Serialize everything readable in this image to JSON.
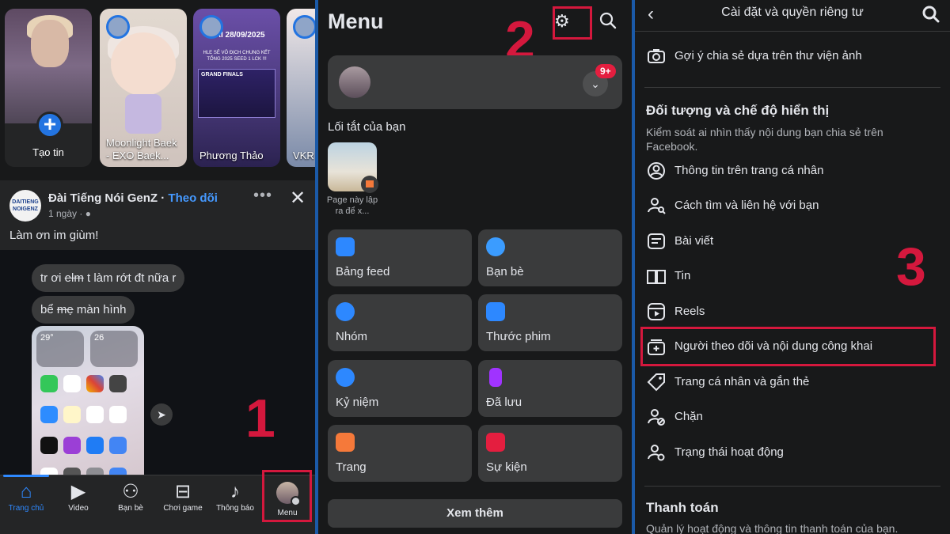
{
  "panel1": {
    "stories": [
      {
        "name": "Tạo tin"
      },
      {
        "name": "Moonlight Baek - EXO Baek..."
      },
      {
        "name": "Phương Thảo",
        "poster_title": "MAI 28/09/2025",
        "poster_sub": "HLE SẼ VÔ ĐỊCH CHUNG KẾT TỔNG 2025 SEED 1 LCK !!!",
        "poster_grand": "GRAND FINALS"
      },
      {
        "name": "VKR"
      }
    ],
    "post": {
      "page_name": "Đài Tiếng Nói GenZ",
      "follow": "Theo dõi",
      "separator": " · ",
      "time": "1 ngày · ",
      "logo_text": "DAITIENG NOIGENZ",
      "text": "Làm ơn im giùm!",
      "bubble1_pre": "tr ơi ",
      "bubble1_strike": "elm",
      "bubble1_post": " t làm rớt đt nữa r",
      "bubble2_pre": "bể ",
      "bubble2_strike": "mẹ",
      "bubble2_post": " màn hình",
      "widget1": "29°",
      "widget2": "26"
    },
    "nav": [
      {
        "label": "Trang chủ",
        "icon": "home-icon"
      },
      {
        "label": "Video",
        "icon": "video-icon"
      },
      {
        "label": "Bạn bè",
        "icon": "friends-icon"
      },
      {
        "label": "Chơi game",
        "icon": "gamepad-icon"
      },
      {
        "label": "Thông báo",
        "icon": "bell-icon"
      },
      {
        "label": "Menu",
        "icon": "avatar"
      }
    ]
  },
  "panel2": {
    "title": "Menu",
    "badge": "9+",
    "shortcuts_title": "Lối tắt của bạn",
    "shortcut_label": "Page này lập ra để x...",
    "tiles": [
      {
        "label": "Bảng feed",
        "icon": "feed-icon",
        "color": "#2d88ff"
      },
      {
        "label": "Bạn bè",
        "icon": "friends-icon",
        "color": "#3b9cff"
      },
      {
        "label": "Nhóm",
        "icon": "groups-icon",
        "color": "#2d88ff"
      },
      {
        "label": "Thước phim",
        "icon": "reels-icon",
        "color": "#2d88ff"
      },
      {
        "label": "Kỷ niệm",
        "icon": "memories-icon",
        "color": "#2d88ff"
      },
      {
        "label": "Đã lưu",
        "icon": "saved-icon",
        "color": "#a033ff"
      },
      {
        "label": "Trang",
        "icon": "pages-icon",
        "color": "#f5793a"
      },
      {
        "label": "Sự kiện",
        "icon": "events-icon",
        "color": "#e41e3f"
      }
    ],
    "see_more": "Xem thêm"
  },
  "panel3": {
    "title": "Cài đặt và quyền riêng tư",
    "top_item": "Gợi ý chia sẻ dựa trên thư viện ảnh",
    "section1_title": "Đối tượng và chế độ hiển thị",
    "section1_desc": "Kiểm soát ai nhìn thấy nội dung bạn chia sẻ trên Facebook.",
    "items": [
      {
        "label": "Thông tin trên trang cá nhân",
        "icon": "profile-icon"
      },
      {
        "label": "Cách tìm và liên hệ với bạn",
        "icon": "find-contact-icon"
      },
      {
        "label": "Bài viết",
        "icon": "posts-icon"
      },
      {
        "label": "Tin",
        "icon": "stories-icon"
      },
      {
        "label": "Reels",
        "icon": "reels-icon"
      },
      {
        "label": "Người theo dõi và nội dung công khai",
        "icon": "followers-icon"
      },
      {
        "label": "Trang cá nhân và gắn thẻ",
        "icon": "tag-icon"
      },
      {
        "label": "Chặn",
        "icon": "block-icon"
      },
      {
        "label": "Trạng thái hoạt động",
        "icon": "activity-status-icon"
      }
    ],
    "section2_title": "Thanh toán",
    "section2_desc": "Quản lý hoạt động và thông tin thanh toán của bạn."
  },
  "annotations": {
    "step1": "1",
    "step2": "2",
    "step3": "3"
  },
  "colors": {
    "annotation": "#d4183d",
    "accent": "#2e89ff",
    "background": "#18191a",
    "divider": "#1b5aa8"
  }
}
